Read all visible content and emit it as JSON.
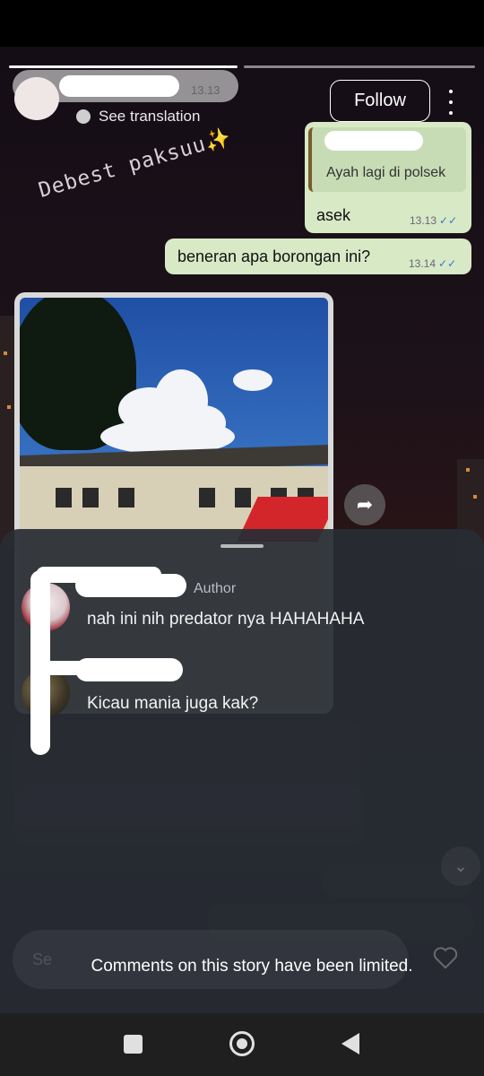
{
  "story": {
    "time": "13.13",
    "see_translation": "See translation",
    "follow_label": "Follow",
    "sticker_text": "Debest paksuu",
    "sticker_emoji": "✨"
  },
  "chat": {
    "quoted_text": "Ayah lagi di polsek",
    "msg1": "asek",
    "msg1_time": "13.13",
    "msg2": "beneran apa borongan ini?",
    "msg2_time": "13.14",
    "ticks": "✓✓"
  },
  "comments": {
    "author_label": "Author",
    "items": [
      {
        "text": "nah ini nih predator nya HAHAHAHA"
      },
      {
        "text": "Kicau mania juga kak?"
      }
    ]
  },
  "footer": {
    "limited_notice": "Comments on this story have been limited."
  },
  "colors": {
    "sent_bubble": "#d7e9c5",
    "sheet": "#282c34",
    "read_ticks": "#2e7ad6"
  },
  "icons": [
    "see-translation-icon",
    "more-icon",
    "share-icon",
    "heart-icon",
    "chevron-down-icon",
    "nav-recents-icon",
    "nav-home-icon",
    "nav-back-icon"
  ]
}
